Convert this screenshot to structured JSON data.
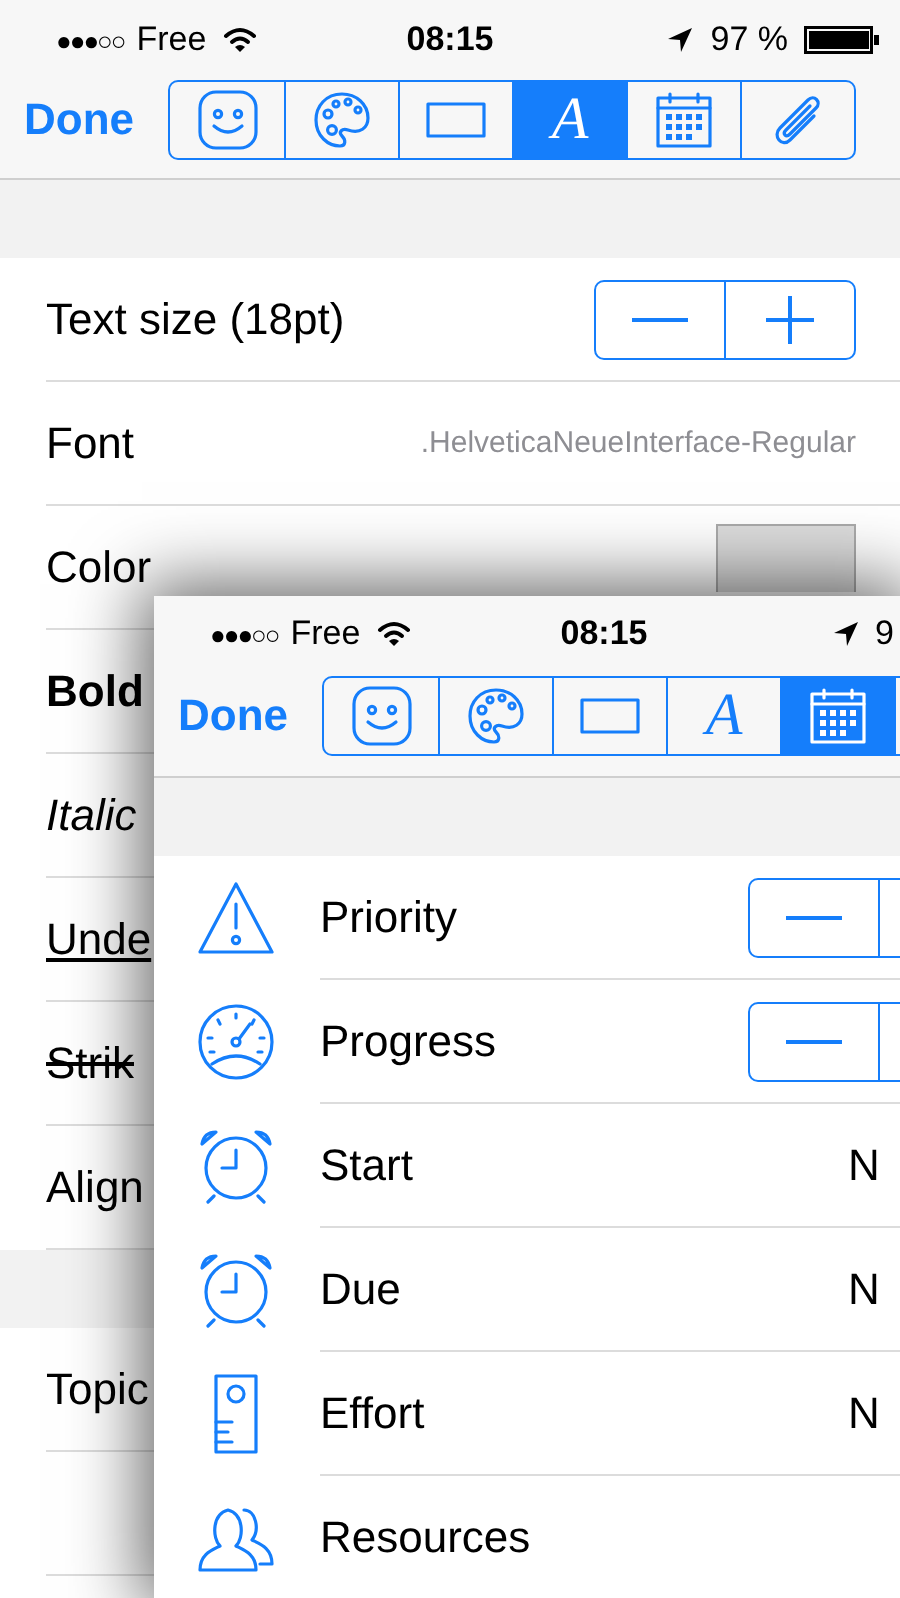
{
  "back": {
    "status_bar": {
      "signal": "●●●○○",
      "carrier": "Free",
      "time": "08:15",
      "battery": "97 %"
    },
    "nav": {
      "done": "Done",
      "segments": [
        {
          "selected": false
        },
        {
          "selected": false
        },
        {
          "selected": false
        },
        {
          "selected": true,
          "text": "A"
        },
        {
          "selected": false
        },
        {
          "selected": false
        }
      ]
    },
    "sections": [
      {
        "rows": [
          {
            "kind": "stepper",
            "label": "Text size (18pt)"
          },
          {
            "kind": "value",
            "label": "Font",
            "value": ".HelveticaNeueInterface-Regular"
          },
          {
            "kind": "swatch",
            "label": "Color"
          },
          {
            "kind": "bold",
            "label": "Bold"
          },
          {
            "kind": "italic",
            "label": "Italic"
          },
          {
            "kind": "underline",
            "label": "Unde"
          },
          {
            "kind": "strike",
            "label": "Strik"
          },
          {
            "kind": "plain",
            "label": "Align"
          }
        ]
      },
      {
        "rows": [
          {
            "kind": "plain",
            "label": "Topic"
          }
        ]
      }
    ]
  },
  "front": {
    "status_bar": {
      "signal": "●●●○○",
      "carrier": "Free",
      "time": "08:15",
      "battery": "9"
    },
    "nav": {
      "done": "Done",
      "segments": [
        {
          "selected": false
        },
        {
          "selected": false
        },
        {
          "selected": false
        },
        {
          "selected": false,
          "text": "A"
        },
        {
          "selected": true
        }
      ]
    },
    "rows": [
      {
        "kind": "stepper",
        "label": "Priority"
      },
      {
        "kind": "stepper",
        "label": "Progress"
      },
      {
        "kind": "value",
        "label": "Start",
        "value": "N"
      },
      {
        "kind": "value",
        "label": "Due",
        "value": "N"
      },
      {
        "kind": "value",
        "label": "Effort",
        "value": "N"
      },
      {
        "kind": "plain",
        "label": "Resources"
      }
    ]
  }
}
